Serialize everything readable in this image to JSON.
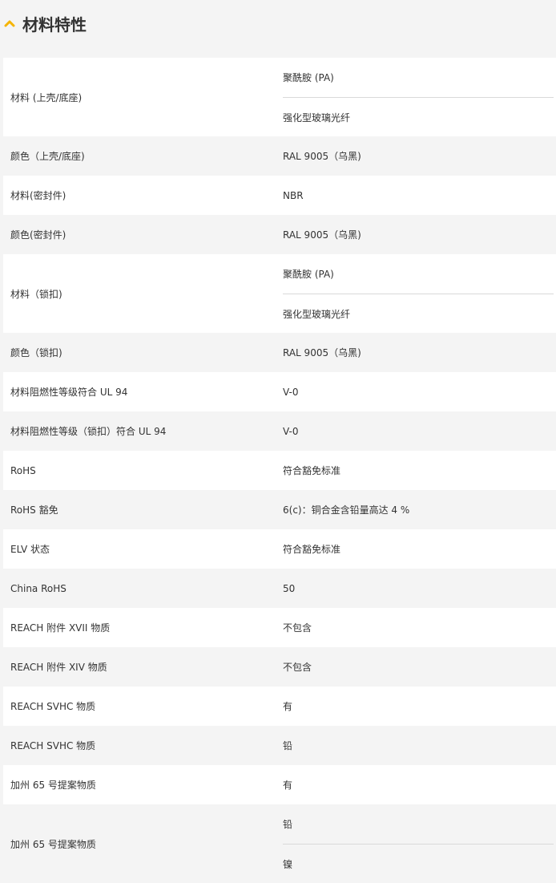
{
  "section": {
    "title": "材料特性",
    "icon": "chevron-up-icon",
    "accent": "#f5b400"
  },
  "rows": [
    {
      "label": "材料 (上壳/底座)",
      "values": [
        "聚酰胺 (PA)",
        "强化型玻璃光纤"
      ]
    },
    {
      "label": "颜色（上壳/底座)",
      "values": [
        "RAL 9005（乌黑)"
      ]
    },
    {
      "label": "材料(密封件)",
      "values": [
        "NBR"
      ]
    },
    {
      "label": "颜色(密封件)",
      "values": [
        "RAL 9005（乌黑)"
      ]
    },
    {
      "label": "材料（锁扣)",
      "values": [
        "聚酰胺 (PA)",
        "强化型玻璃光纤"
      ]
    },
    {
      "label": "颜色（锁扣)",
      "values": [
        "RAL 9005（乌黑)"
      ]
    },
    {
      "label": "材料阻燃性等级符合 UL 94",
      "values": [
        "V-0"
      ]
    },
    {
      "label": "材料阻燃性等级（锁扣）符合 UL 94",
      "values": [
        "V-0"
      ]
    },
    {
      "label": "RoHS",
      "values": [
        "符合豁免标准"
      ]
    },
    {
      "label": "RoHS 豁免",
      "values": [
        "6(c)：铜合金含铅量高达 4 %"
      ]
    },
    {
      "label": "ELV 状态",
      "values": [
        "符合豁免标准"
      ]
    },
    {
      "label": "China RoHS",
      "values": [
        "50"
      ]
    },
    {
      "label": "REACH 附件 XVII 物质",
      "values": [
        "不包含"
      ]
    },
    {
      "label": "REACH 附件 XIV 物质",
      "values": [
        "不包含"
      ]
    },
    {
      "label": "REACH SVHC 物质",
      "values": [
        "有"
      ]
    },
    {
      "label": "REACH SVHC 物质",
      "values": [
        "铅"
      ]
    },
    {
      "label": "加州 65 号提案物质",
      "values": [
        "有"
      ]
    },
    {
      "label": "加州 65 号提案物质",
      "values": [
        "铅",
        "镍"
      ]
    }
  ]
}
